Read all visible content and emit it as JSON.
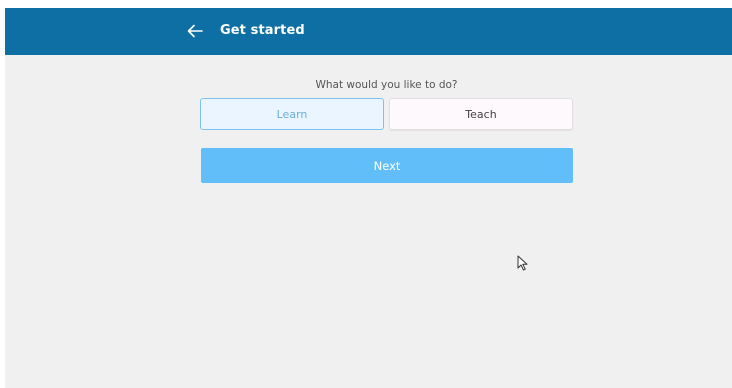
{
  "header": {
    "back_icon": "arrow-left-icon",
    "title": "Get started"
  },
  "main": {
    "prompt": "What would you like to do?",
    "options": [
      {
        "label": "Learn",
        "selected": true
      },
      {
        "label": "Teach",
        "selected": false
      }
    ],
    "next_label": "Next"
  },
  "colors": {
    "app_bar": "#0e6fa5",
    "background": "#f0f0f0",
    "selected_option_bg": "#eaf5ff",
    "selected_option_border": "#7cc4ef",
    "next_button": "#61bef8"
  }
}
